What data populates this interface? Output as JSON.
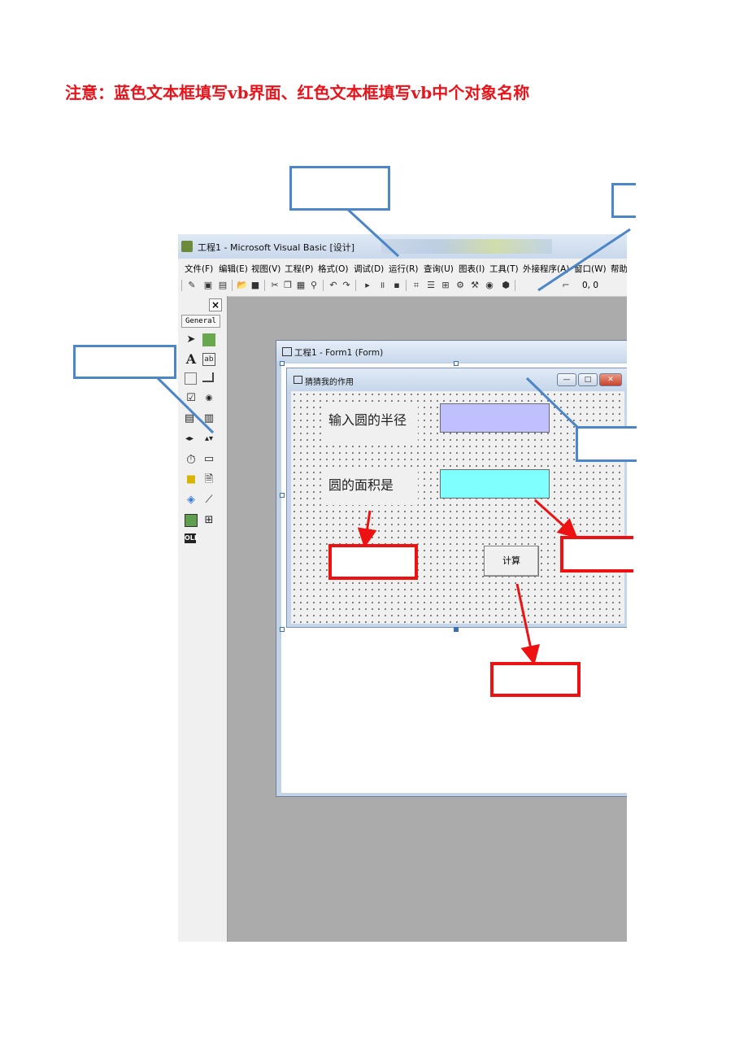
{
  "note": "注意：蓝色文本框填写vb界面、红色文本框填写vb中个对象名称",
  "ide": {
    "title": "工程1 - Microsoft Visual Basic [设计]",
    "menu": [
      "文件(F)",
      "编辑(E)",
      "视图(V)",
      "工程(P)",
      "格式(O)",
      "调试(D)",
      "运行(R)",
      "查询(U)",
      "图表(I)",
      "工具(T)",
      "外接程序(A)",
      "窗口(W)",
      "帮助"
    ],
    "coords": "0, 0",
    "toolbox_close": "×",
    "toolbox_tab": "General"
  },
  "designer": {
    "caption": "工程1 - Form1 (Form)",
    "form_caption": "猜猜我的作用",
    "label1": "输入圆的半径",
    "label2": "圆的面积是",
    "button": "计算",
    "text1_color": "#c0c0ff",
    "text2_color": "#80ffff"
  },
  "colors": {
    "note": "#e8141c",
    "blue_box": "#4a86c8",
    "red_box": "#ee1111"
  }
}
